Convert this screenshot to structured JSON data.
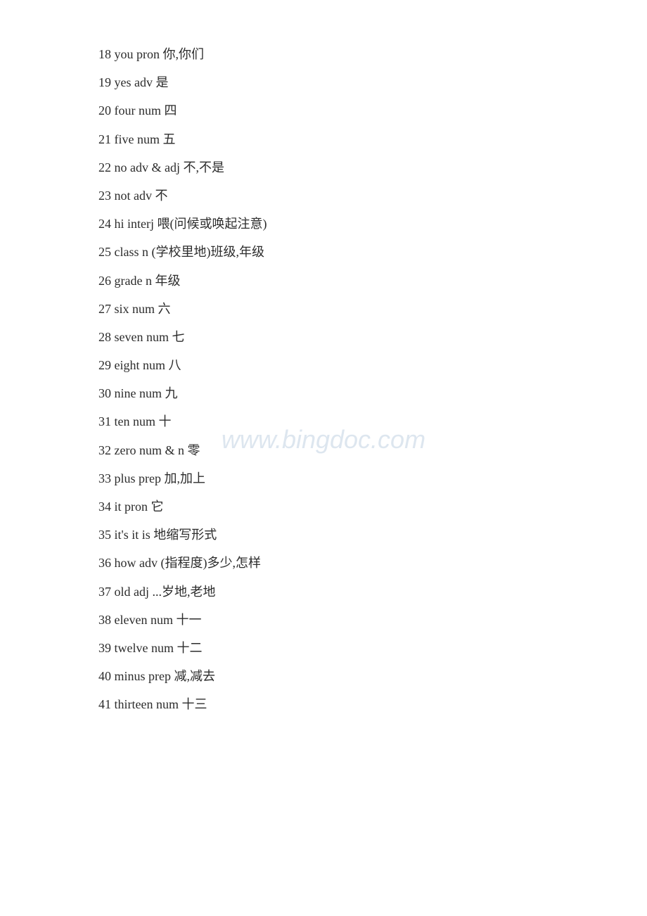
{
  "watermark": {
    "text": "www.bingdoc.com"
  },
  "vocab": {
    "items": [
      {
        "id": 18,
        "word": "you",
        "pos": "pron",
        "definition": "你,你们"
      },
      {
        "id": 19,
        "word": "yes",
        "pos": "adv",
        "definition": "是"
      },
      {
        "id": 20,
        "word": "four",
        "pos": "num",
        "definition": "四"
      },
      {
        "id": 21,
        "word": "five",
        "pos": "num",
        "definition": "五"
      },
      {
        "id": 22,
        "word": "no",
        "pos": "adv & adj",
        "definition": "不,不是"
      },
      {
        "id": 23,
        "word": "not",
        "pos": "adv",
        "definition": "不"
      },
      {
        "id": 24,
        "word": "hi",
        "pos": "interj",
        "definition": "喂(问候或唤起注意)"
      },
      {
        "id": 25,
        "word": "class",
        "pos": "n",
        "definition": "(学校里地)班级,年级"
      },
      {
        "id": 26,
        "word": "grade",
        "pos": "n",
        "definition": "年级"
      },
      {
        "id": 27,
        "word": "six",
        "pos": "num",
        "definition": "六"
      },
      {
        "id": 28,
        "word": "seven",
        "pos": "num",
        "definition": "七"
      },
      {
        "id": 29,
        "word": "eight",
        "pos": "num",
        "definition": "八"
      },
      {
        "id": 30,
        "word": "nine",
        "pos": "num",
        "definition": "九"
      },
      {
        "id": 31,
        "word": "ten",
        "pos": "num",
        "definition": "十"
      },
      {
        "id": 32,
        "word": "zero",
        "pos": "num & n",
        "definition": "零"
      },
      {
        "id": 33,
        "word": "plus",
        "pos": "prep",
        "definition": "加,加上"
      },
      {
        "id": 34,
        "word": "it",
        "pos": "pron",
        "definition": "它"
      },
      {
        "id": 35,
        "word": "it's",
        "pos": "it is",
        "definition": "地缩写形式"
      },
      {
        "id": 36,
        "word": "how",
        "pos": "adv",
        "definition": "(指程度)多少,怎样"
      },
      {
        "id": 37,
        "word": "old",
        "pos": "adj",
        "definition": "...岁地,老地"
      },
      {
        "id": 38,
        "word": "eleven",
        "pos": "num",
        "definition": "十一"
      },
      {
        "id": 39,
        "word": "twelve",
        "pos": "num",
        "definition": "十二"
      },
      {
        "id": 40,
        "word": "minus",
        "pos": "prep",
        "definition": "减,减去"
      },
      {
        "id": 41,
        "word": "thirteen",
        "pos": "num",
        "definition": "十三"
      }
    ]
  }
}
